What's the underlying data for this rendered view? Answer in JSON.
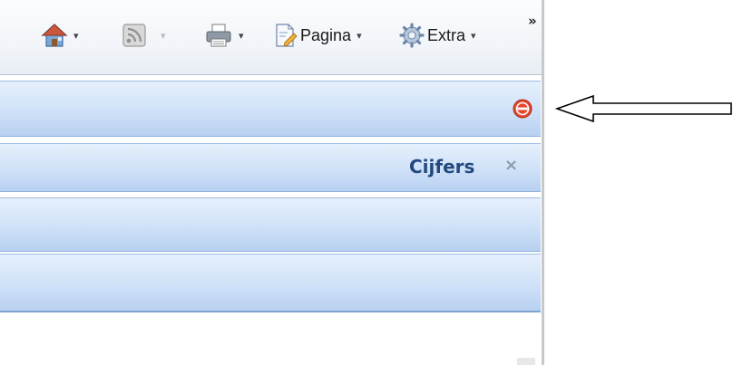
{
  "toolbar": {
    "home_icon": "home-icon",
    "feeds_icon": "rss-feeds-icon",
    "print_icon": "printer-icon",
    "page_label": "Pagina",
    "extra_label": "Extra",
    "dropdown_glyph": "▾",
    "overflow_chevron": "»"
  },
  "panel": {
    "stop_icon": "stop-remove-icon",
    "tab_title": "Cijfers",
    "close_glyph": "×"
  },
  "annotation": {
    "arrow": "left-pointing-outline-arrow"
  },
  "colors": {
    "band_light": "#e6f0fc",
    "band_dark": "#b8d0f0",
    "title_text": "#234a80",
    "stop_red": "#e8452c"
  }
}
